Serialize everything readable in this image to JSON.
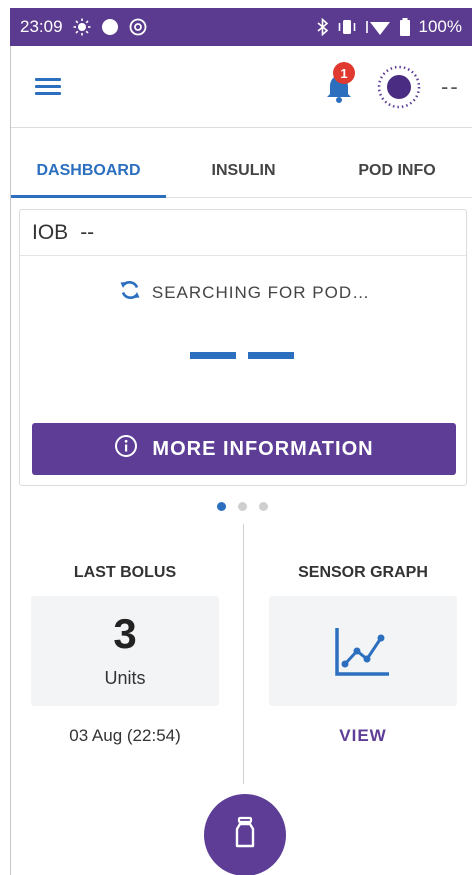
{
  "status_bar": {
    "time": "23:09",
    "battery": "100%",
    "background_color": "#5b3b8f"
  },
  "app_bar": {
    "notification_count": "1",
    "pod_status_text": "--"
  },
  "tabs": [
    {
      "label": "DASHBOARD",
      "active": true
    },
    {
      "label": "INSULIN",
      "active": false
    },
    {
      "label": "POD INFO",
      "active": false
    }
  ],
  "card": {
    "iob_label": "IOB",
    "iob_value": "--",
    "status_text": "SEARCHING FOR POD…",
    "more_info_label": "MORE INFORMATION"
  },
  "pager": {
    "count": 3,
    "active_index": 0
  },
  "last_bolus": {
    "title": "LAST BOLUS",
    "value": "3",
    "units": "Units",
    "timestamp": "03 Aug (22:54)"
  },
  "sensor_graph": {
    "title": "SENSOR GRAPH",
    "view_label": "VIEW"
  },
  "colors": {
    "accent_blue": "#2c6fbf",
    "primary_purple": "#5d3d96",
    "badge_red": "#e0392f"
  },
  "icons": {
    "menu": "hamburger-menu-icon",
    "bell": "bell-icon",
    "pod": "pod-status-icon",
    "sync": "sync-icon",
    "info": "info-icon",
    "graph": "line-chart-icon",
    "fab": "bolus-icon"
  }
}
